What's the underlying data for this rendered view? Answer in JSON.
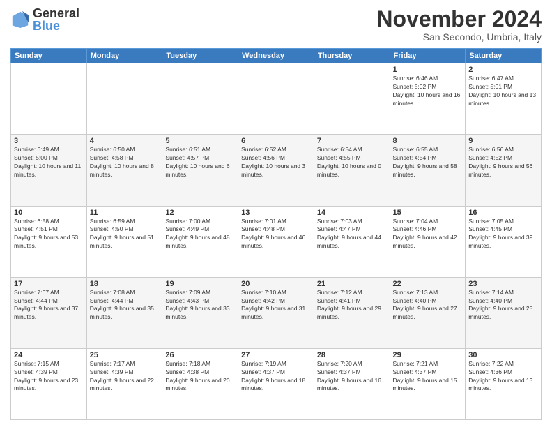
{
  "logo": {
    "general": "General",
    "blue": "Blue"
  },
  "title": "November 2024",
  "subtitle": "San Secondo, Umbria, Italy",
  "days_of_week": [
    "Sunday",
    "Monday",
    "Tuesday",
    "Wednesday",
    "Thursday",
    "Friday",
    "Saturday"
  ],
  "weeks": [
    [
      {
        "day": "",
        "info": ""
      },
      {
        "day": "",
        "info": ""
      },
      {
        "day": "",
        "info": ""
      },
      {
        "day": "",
        "info": ""
      },
      {
        "day": "",
        "info": ""
      },
      {
        "day": "1",
        "info": "Sunrise: 6:46 AM\nSunset: 5:02 PM\nDaylight: 10 hours and 16 minutes."
      },
      {
        "day": "2",
        "info": "Sunrise: 6:47 AM\nSunset: 5:01 PM\nDaylight: 10 hours and 13 minutes."
      }
    ],
    [
      {
        "day": "3",
        "info": "Sunrise: 6:49 AM\nSunset: 5:00 PM\nDaylight: 10 hours and 11 minutes."
      },
      {
        "day": "4",
        "info": "Sunrise: 6:50 AM\nSunset: 4:58 PM\nDaylight: 10 hours and 8 minutes."
      },
      {
        "day": "5",
        "info": "Sunrise: 6:51 AM\nSunset: 4:57 PM\nDaylight: 10 hours and 6 minutes."
      },
      {
        "day": "6",
        "info": "Sunrise: 6:52 AM\nSunset: 4:56 PM\nDaylight: 10 hours and 3 minutes."
      },
      {
        "day": "7",
        "info": "Sunrise: 6:54 AM\nSunset: 4:55 PM\nDaylight: 10 hours and 0 minutes."
      },
      {
        "day": "8",
        "info": "Sunrise: 6:55 AM\nSunset: 4:54 PM\nDaylight: 9 hours and 58 minutes."
      },
      {
        "day": "9",
        "info": "Sunrise: 6:56 AM\nSunset: 4:52 PM\nDaylight: 9 hours and 56 minutes."
      }
    ],
    [
      {
        "day": "10",
        "info": "Sunrise: 6:58 AM\nSunset: 4:51 PM\nDaylight: 9 hours and 53 minutes."
      },
      {
        "day": "11",
        "info": "Sunrise: 6:59 AM\nSunset: 4:50 PM\nDaylight: 9 hours and 51 minutes."
      },
      {
        "day": "12",
        "info": "Sunrise: 7:00 AM\nSunset: 4:49 PM\nDaylight: 9 hours and 48 minutes."
      },
      {
        "day": "13",
        "info": "Sunrise: 7:01 AM\nSunset: 4:48 PM\nDaylight: 9 hours and 46 minutes."
      },
      {
        "day": "14",
        "info": "Sunrise: 7:03 AM\nSunset: 4:47 PM\nDaylight: 9 hours and 44 minutes."
      },
      {
        "day": "15",
        "info": "Sunrise: 7:04 AM\nSunset: 4:46 PM\nDaylight: 9 hours and 42 minutes."
      },
      {
        "day": "16",
        "info": "Sunrise: 7:05 AM\nSunset: 4:45 PM\nDaylight: 9 hours and 39 minutes."
      }
    ],
    [
      {
        "day": "17",
        "info": "Sunrise: 7:07 AM\nSunset: 4:44 PM\nDaylight: 9 hours and 37 minutes."
      },
      {
        "day": "18",
        "info": "Sunrise: 7:08 AM\nSunset: 4:44 PM\nDaylight: 9 hours and 35 minutes."
      },
      {
        "day": "19",
        "info": "Sunrise: 7:09 AM\nSunset: 4:43 PM\nDaylight: 9 hours and 33 minutes."
      },
      {
        "day": "20",
        "info": "Sunrise: 7:10 AM\nSunset: 4:42 PM\nDaylight: 9 hours and 31 minutes."
      },
      {
        "day": "21",
        "info": "Sunrise: 7:12 AM\nSunset: 4:41 PM\nDaylight: 9 hours and 29 minutes."
      },
      {
        "day": "22",
        "info": "Sunrise: 7:13 AM\nSunset: 4:40 PM\nDaylight: 9 hours and 27 minutes."
      },
      {
        "day": "23",
        "info": "Sunrise: 7:14 AM\nSunset: 4:40 PM\nDaylight: 9 hours and 25 minutes."
      }
    ],
    [
      {
        "day": "24",
        "info": "Sunrise: 7:15 AM\nSunset: 4:39 PM\nDaylight: 9 hours and 23 minutes."
      },
      {
        "day": "25",
        "info": "Sunrise: 7:17 AM\nSunset: 4:39 PM\nDaylight: 9 hours and 22 minutes."
      },
      {
        "day": "26",
        "info": "Sunrise: 7:18 AM\nSunset: 4:38 PM\nDaylight: 9 hours and 20 minutes."
      },
      {
        "day": "27",
        "info": "Sunrise: 7:19 AM\nSunset: 4:37 PM\nDaylight: 9 hours and 18 minutes."
      },
      {
        "day": "28",
        "info": "Sunrise: 7:20 AM\nSunset: 4:37 PM\nDaylight: 9 hours and 16 minutes."
      },
      {
        "day": "29",
        "info": "Sunrise: 7:21 AM\nSunset: 4:37 PM\nDaylight: 9 hours and 15 minutes."
      },
      {
        "day": "30",
        "info": "Sunrise: 7:22 AM\nSunset: 4:36 PM\nDaylight: 9 hours and 13 minutes."
      }
    ]
  ]
}
